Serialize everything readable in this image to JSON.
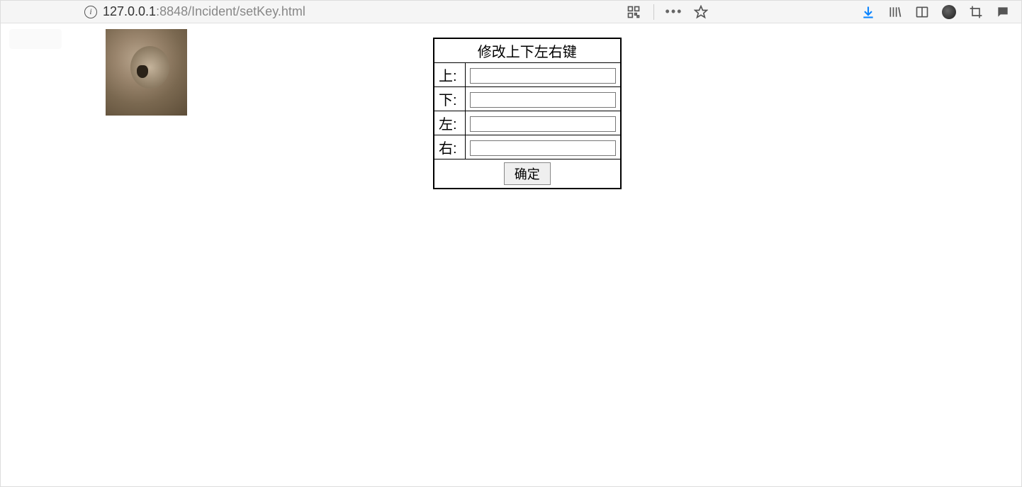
{
  "browser": {
    "url_host": "127.0.0.1",
    "url_rest": ":8848/Incident/setKey.html"
  },
  "form": {
    "title": "修改上下左右键",
    "rows": [
      {
        "label": "上:",
        "value": ""
      },
      {
        "label": "下:",
        "value": ""
      },
      {
        "label": "左:",
        "value": ""
      },
      {
        "label": "右:",
        "value": ""
      }
    ],
    "submit_label": "确定"
  }
}
